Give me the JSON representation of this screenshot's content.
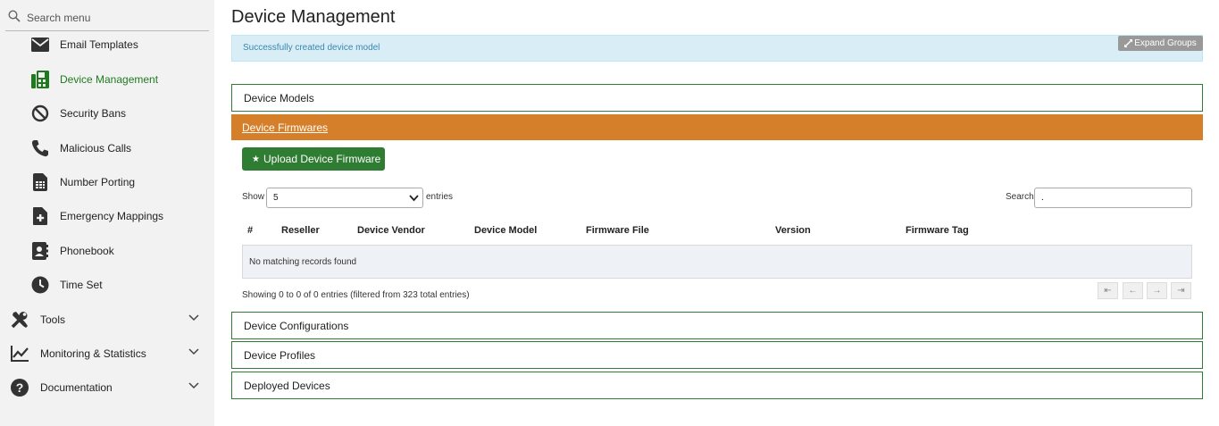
{
  "sidebar": {
    "search_placeholder": "Search menu",
    "items": [
      {
        "label": "Email Templates",
        "icon": "envelope-icon"
      },
      {
        "label": "Device Management",
        "icon": "fax-icon",
        "active": true
      },
      {
        "label": "Security Bans",
        "icon": "ban-icon"
      },
      {
        "label": "Malicious Calls",
        "icon": "phone-icon"
      },
      {
        "label": "Number Porting",
        "icon": "sim-card-icon"
      },
      {
        "label": "Emergency Mappings",
        "icon": "file-medical-icon"
      },
      {
        "label": "Phonebook",
        "icon": "address-book-icon"
      },
      {
        "label": "Time Set",
        "icon": "clock-icon"
      }
    ],
    "groups": [
      {
        "label": "Tools",
        "icon": "tools-icon"
      },
      {
        "label": "Monitoring & Statistics",
        "icon": "chart-line-icon"
      },
      {
        "label": "Documentation",
        "icon": "question-circle-icon"
      }
    ]
  },
  "page": {
    "title": "Device Management",
    "alert": "Successfully created device model",
    "expand_groups": "Expand Groups"
  },
  "sections": {
    "models": "Device Models",
    "firmwares": "Device Firmwares",
    "configurations": "Device Configurations",
    "profiles": "Device Profiles",
    "deployed": "Deployed Devices"
  },
  "firmwares": {
    "upload_button": "Upload Device Firmware",
    "show_label": "Show",
    "page_length": "5",
    "entries_label": "entries",
    "search_label": "Search:",
    "search_value": ".",
    "columns": [
      "#",
      "Reseller",
      "Device Vendor",
      "Device Model",
      "Firmware File",
      "Version",
      "Firmware Tag"
    ],
    "empty_message": "No matching records found",
    "info": "Showing 0 to 0 of 0 entries (filtered from 323 total entries)",
    "pager": [
      "⇤",
      "←",
      "→",
      "⇥"
    ]
  },
  "colors": {
    "accent_green": "#2e7d32",
    "active_header": "#d67f2b",
    "alert_bg": "#d9edf7"
  }
}
